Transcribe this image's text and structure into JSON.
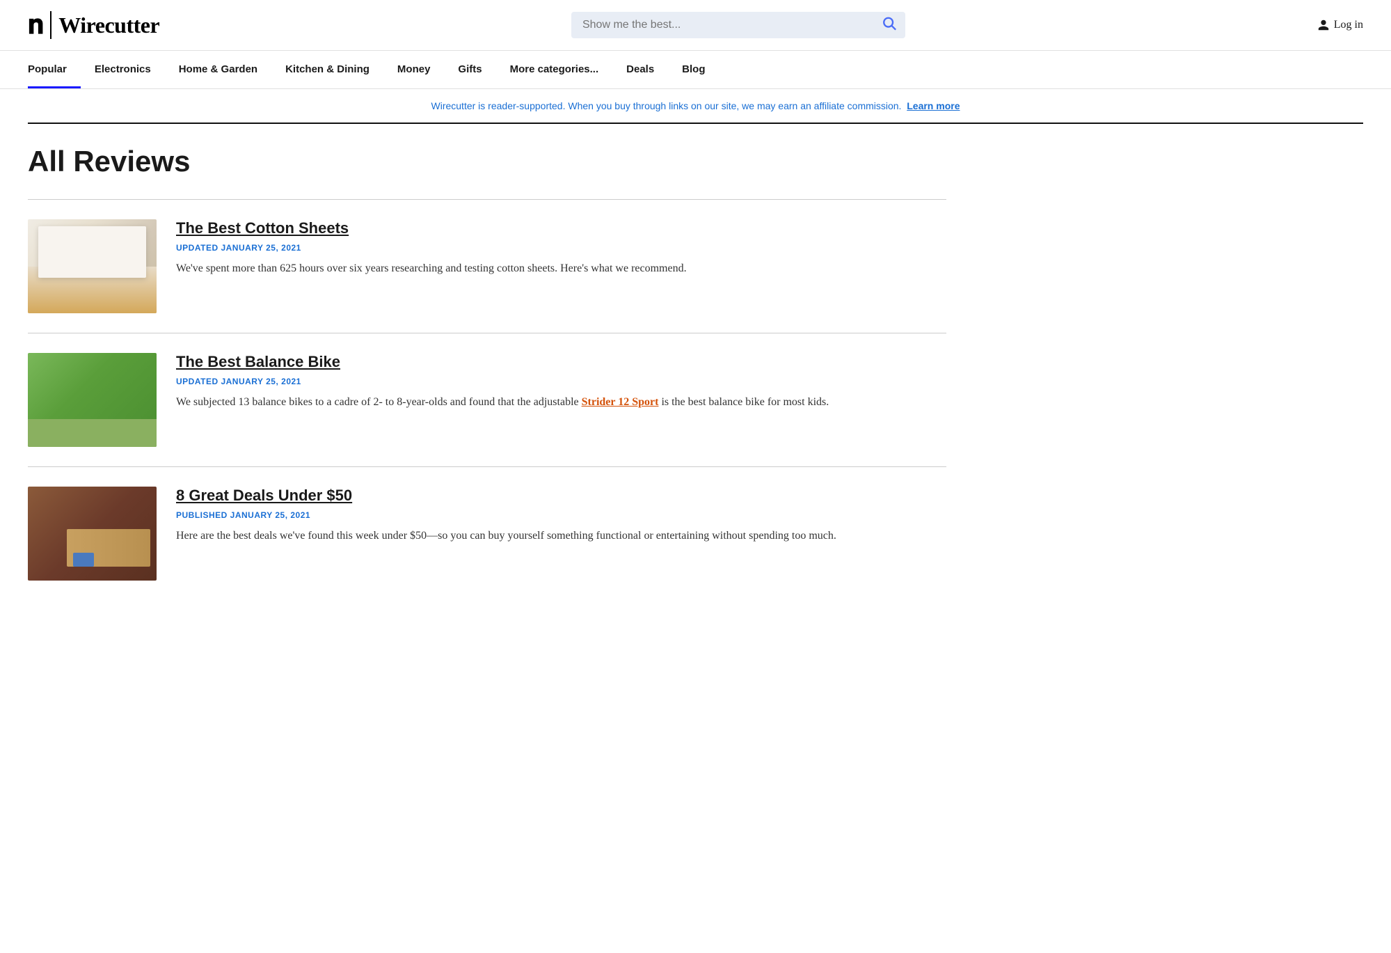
{
  "header": {
    "logo_nyt": "𝕿",
    "logo_divider": "|",
    "logo_wirecutter": "Wirecutter",
    "search_placeholder": "Show me the best...",
    "login_label": "Log in"
  },
  "nav": {
    "items": [
      {
        "label": "Popular",
        "active": true
      },
      {
        "label": "Electronics",
        "active": false
      },
      {
        "label": "Home & Garden",
        "active": false
      },
      {
        "label": "Kitchen & Dining",
        "active": false
      },
      {
        "label": "Money",
        "active": false
      },
      {
        "label": "Gifts",
        "active": false
      },
      {
        "label": "More categories...",
        "active": false
      },
      {
        "label": "Deals",
        "active": false
      },
      {
        "label": "Blog",
        "active": false
      }
    ]
  },
  "affiliate": {
    "text": "Wirecutter is reader-supported. When you buy through links on our site, we may earn an affiliate commission.",
    "link_label": "Learn more"
  },
  "page": {
    "title": "All Reviews"
  },
  "reviews": [
    {
      "id": "cotton-sheets",
      "title": "The Best Cotton Sheets",
      "date_label": "UPDATED JANUARY 25, 2021",
      "description": "We've spent more than 625 hours over six years researching and testing cotton sheets. Here's what we recommend.",
      "has_link": false,
      "link_text": "",
      "link_anchor": ""
    },
    {
      "id": "balance-bike",
      "title": "The Best Balance Bike",
      "date_label": "UPDATED JANUARY 25, 2021",
      "description_before": "We subjected 13 balance bikes to a cadre of 2- to 8-year-olds and found that the adjustable ",
      "description_after": " is the best balance bike for most kids.",
      "has_link": true,
      "link_text": "Strider 12 Sport",
      "link_anchor": ""
    },
    {
      "id": "deals-under-50",
      "title": "8 Great Deals Under $50",
      "date_label": "PUBLISHED JANUARY 25, 2021",
      "description": "Here are the best deals we've found this week under $50—so you can buy yourself something functional or entertaining without spending too much.",
      "has_link": false,
      "link_text": "",
      "link_anchor": ""
    }
  ]
}
